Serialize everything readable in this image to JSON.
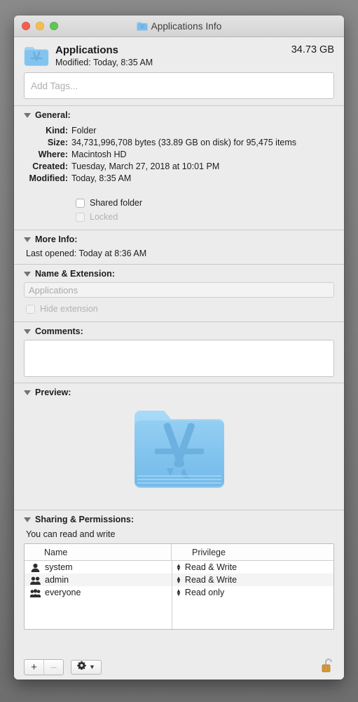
{
  "window": {
    "title": "Applications Info",
    "title_icon": "folder-applications-icon",
    "controls": {
      "close": "close-button",
      "minimize": "minimize-button",
      "zoom": "zoom-button"
    }
  },
  "header": {
    "icon": "folder-applications-icon",
    "name": "Applications",
    "modified": "Modified: Today, 8:35 AM",
    "size": "34.73 GB"
  },
  "tags": {
    "placeholder": "Add Tags...",
    "value": ""
  },
  "general": {
    "title": "General:",
    "rows": [
      {
        "label": "Kind:",
        "value": "Folder"
      },
      {
        "label": "Size:",
        "value": "34,731,996,708 bytes (33.89 GB on disk) for 95,475 items"
      },
      {
        "label": "Where:",
        "value": "Macintosh HD"
      },
      {
        "label": "Created:",
        "value": "Tuesday, March 27, 2018 at 10:01 PM"
      },
      {
        "label": "Modified:",
        "value": "Today, 8:35 AM"
      }
    ],
    "checkboxes": [
      {
        "label": "Shared folder",
        "checked": false,
        "enabled": true
      },
      {
        "label": "Locked",
        "checked": false,
        "enabled": false
      }
    ]
  },
  "more_info": {
    "title": "More Info:",
    "last_opened": "Last opened: Today at 8:36 AM"
  },
  "name_extension": {
    "title": "Name & Extension:",
    "value": "Applications",
    "hide_extension_label": "Hide extension",
    "hide_extension_checked": false,
    "hide_extension_enabled": false
  },
  "comments": {
    "title": "Comments:",
    "value": ""
  },
  "preview": {
    "title": "Preview:",
    "icon": "folder-applications-icon"
  },
  "sharing": {
    "title": "Sharing & Permissions:",
    "status": "You can read and write",
    "columns": [
      "Name",
      "Privilege"
    ],
    "rows": [
      {
        "icon": "single-user-icon",
        "name": "system",
        "privilege": "Read & Write"
      },
      {
        "icon": "two-users-icon",
        "name": "admin",
        "privilege": "Read & Write"
      },
      {
        "icon": "group-users-icon",
        "name": "everyone",
        "privilege": "Read only"
      }
    ]
  },
  "toolbar": {
    "add_label": "+",
    "remove_label": "–",
    "action_icon": "gear-icon",
    "action_chevron": "chevron-down-icon",
    "lock_icon": "unlocked-padlock-icon"
  },
  "colors": {
    "window_bg": "#ececec",
    "folder_blue": "#7fc0ef",
    "folder_blue_dark": "#5ba9e4",
    "traffic_red": "#f0604e",
    "traffic_yellow": "#f4bd4f",
    "traffic_green": "#61c454",
    "lock_gold": "#d99a38"
  }
}
